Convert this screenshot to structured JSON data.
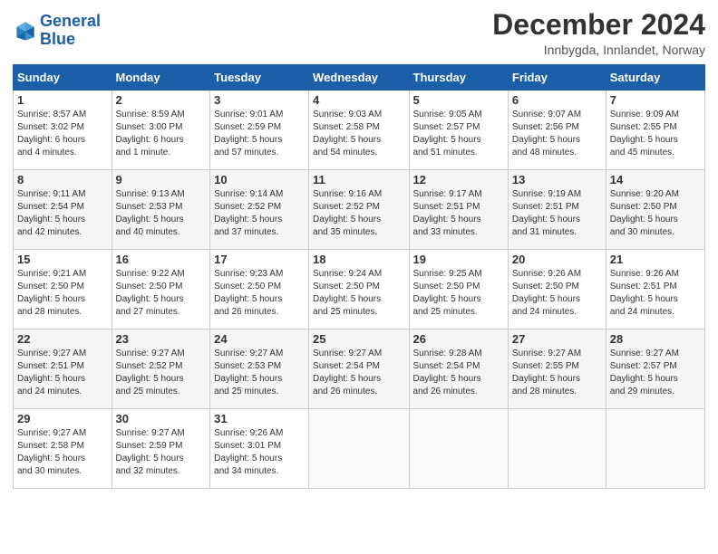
{
  "logo": {
    "line1": "General",
    "line2": "Blue"
  },
  "title": "December 2024",
  "location": "Innbygda, Innlandet, Norway",
  "days_of_week": [
    "Sunday",
    "Monday",
    "Tuesday",
    "Wednesday",
    "Thursday",
    "Friday",
    "Saturday"
  ],
  "weeks": [
    [
      {
        "day": "1",
        "info": "Sunrise: 8:57 AM\nSunset: 3:02 PM\nDaylight: 6 hours\nand 4 minutes."
      },
      {
        "day": "2",
        "info": "Sunrise: 8:59 AM\nSunset: 3:00 PM\nDaylight: 6 hours\nand 1 minute."
      },
      {
        "day": "3",
        "info": "Sunrise: 9:01 AM\nSunset: 2:59 PM\nDaylight: 5 hours\nand 57 minutes."
      },
      {
        "day": "4",
        "info": "Sunrise: 9:03 AM\nSunset: 2:58 PM\nDaylight: 5 hours\nand 54 minutes."
      },
      {
        "day": "5",
        "info": "Sunrise: 9:05 AM\nSunset: 2:57 PM\nDaylight: 5 hours\nand 51 minutes."
      },
      {
        "day": "6",
        "info": "Sunrise: 9:07 AM\nSunset: 2:56 PM\nDaylight: 5 hours\nand 48 minutes."
      },
      {
        "day": "7",
        "info": "Sunrise: 9:09 AM\nSunset: 2:55 PM\nDaylight: 5 hours\nand 45 minutes."
      }
    ],
    [
      {
        "day": "8",
        "info": "Sunrise: 9:11 AM\nSunset: 2:54 PM\nDaylight: 5 hours\nand 42 minutes."
      },
      {
        "day": "9",
        "info": "Sunrise: 9:13 AM\nSunset: 2:53 PM\nDaylight: 5 hours\nand 40 minutes."
      },
      {
        "day": "10",
        "info": "Sunrise: 9:14 AM\nSunset: 2:52 PM\nDaylight: 5 hours\nand 37 minutes."
      },
      {
        "day": "11",
        "info": "Sunrise: 9:16 AM\nSunset: 2:52 PM\nDaylight: 5 hours\nand 35 minutes."
      },
      {
        "day": "12",
        "info": "Sunrise: 9:17 AM\nSunset: 2:51 PM\nDaylight: 5 hours\nand 33 minutes."
      },
      {
        "day": "13",
        "info": "Sunrise: 9:19 AM\nSunset: 2:51 PM\nDaylight: 5 hours\nand 31 minutes."
      },
      {
        "day": "14",
        "info": "Sunrise: 9:20 AM\nSunset: 2:50 PM\nDaylight: 5 hours\nand 30 minutes."
      }
    ],
    [
      {
        "day": "15",
        "info": "Sunrise: 9:21 AM\nSunset: 2:50 PM\nDaylight: 5 hours\nand 28 minutes."
      },
      {
        "day": "16",
        "info": "Sunrise: 9:22 AM\nSunset: 2:50 PM\nDaylight: 5 hours\nand 27 minutes."
      },
      {
        "day": "17",
        "info": "Sunrise: 9:23 AM\nSunset: 2:50 PM\nDaylight: 5 hours\nand 26 minutes."
      },
      {
        "day": "18",
        "info": "Sunrise: 9:24 AM\nSunset: 2:50 PM\nDaylight: 5 hours\nand 25 minutes."
      },
      {
        "day": "19",
        "info": "Sunrise: 9:25 AM\nSunset: 2:50 PM\nDaylight: 5 hours\nand 25 minutes."
      },
      {
        "day": "20",
        "info": "Sunrise: 9:26 AM\nSunset: 2:50 PM\nDaylight: 5 hours\nand 24 minutes."
      },
      {
        "day": "21",
        "info": "Sunrise: 9:26 AM\nSunset: 2:51 PM\nDaylight: 5 hours\nand 24 minutes."
      }
    ],
    [
      {
        "day": "22",
        "info": "Sunrise: 9:27 AM\nSunset: 2:51 PM\nDaylight: 5 hours\nand 24 minutes."
      },
      {
        "day": "23",
        "info": "Sunrise: 9:27 AM\nSunset: 2:52 PM\nDaylight: 5 hours\nand 25 minutes."
      },
      {
        "day": "24",
        "info": "Sunrise: 9:27 AM\nSunset: 2:53 PM\nDaylight: 5 hours\nand 25 minutes."
      },
      {
        "day": "25",
        "info": "Sunrise: 9:27 AM\nSunset: 2:54 PM\nDaylight: 5 hours\nand 26 minutes."
      },
      {
        "day": "26",
        "info": "Sunrise: 9:28 AM\nSunset: 2:54 PM\nDaylight: 5 hours\nand 26 minutes."
      },
      {
        "day": "27",
        "info": "Sunrise: 9:27 AM\nSunset: 2:55 PM\nDaylight: 5 hours\nand 28 minutes."
      },
      {
        "day": "28",
        "info": "Sunrise: 9:27 AM\nSunset: 2:57 PM\nDaylight: 5 hours\nand 29 minutes."
      }
    ],
    [
      {
        "day": "29",
        "info": "Sunrise: 9:27 AM\nSunset: 2:58 PM\nDaylight: 5 hours\nand 30 minutes."
      },
      {
        "day": "30",
        "info": "Sunrise: 9:27 AM\nSunset: 2:59 PM\nDaylight: 5 hours\nand 32 minutes."
      },
      {
        "day": "31",
        "info": "Sunrise: 9:26 AM\nSunset: 3:01 PM\nDaylight: 5 hours\nand 34 minutes."
      },
      {
        "day": "",
        "info": ""
      },
      {
        "day": "",
        "info": ""
      },
      {
        "day": "",
        "info": ""
      },
      {
        "day": "",
        "info": ""
      }
    ]
  ]
}
